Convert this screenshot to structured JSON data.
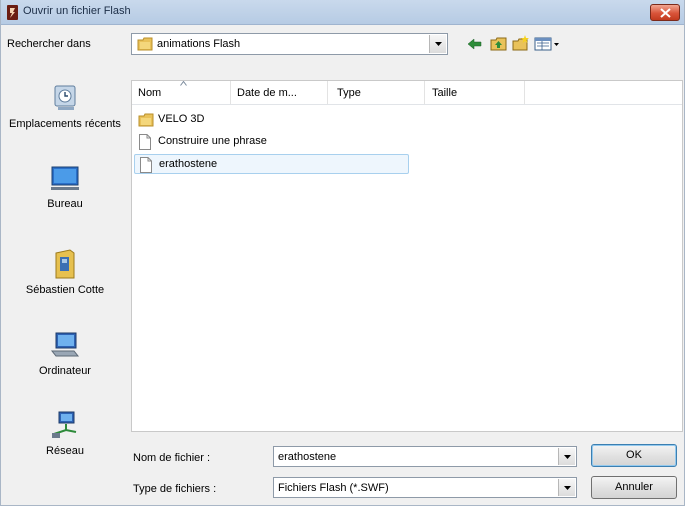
{
  "window": {
    "title": "Ouvrir un fichier Flash"
  },
  "lookin": {
    "label": "Rechercher dans",
    "value": "animations Flash"
  },
  "toolbar": {
    "back_icon": "back-arrow-icon",
    "up_icon": "up-folder-icon",
    "newfolder_icon": "new-folder-icon",
    "views_icon": "views-menu-icon"
  },
  "places": [
    {
      "label": "Emplacements récents",
      "icon": "recent-places-icon"
    },
    {
      "label": "Bureau",
      "icon": "desktop-icon"
    },
    {
      "label": "Sébastien Cotte",
      "icon": "user-folder-icon"
    },
    {
      "label": "Ordinateur",
      "icon": "computer-icon"
    },
    {
      "label": "Réseau",
      "icon": "network-icon"
    }
  ],
  "filelist": {
    "columns": [
      "Nom",
      "Date de m...",
      "Type",
      "Taille"
    ],
    "items": [
      {
        "name": "VELO 3D",
        "kind": "folder"
      },
      {
        "name": "Construire une phrase",
        "kind": "file"
      },
      {
        "name": "erathostene",
        "kind": "file",
        "selected": true
      }
    ]
  },
  "filename": {
    "label": "Nom de fichier :",
    "value": "erathostene"
  },
  "filetype": {
    "label": "Type de fichiers :",
    "value": "Fichiers Flash (*.SWF)"
  },
  "buttons": {
    "ok": "OK",
    "cancel": "Annuler"
  },
  "colors": {
    "titlebar": "#c9d9ec",
    "selection": "#eef6fd",
    "close": "#d9543a"
  }
}
